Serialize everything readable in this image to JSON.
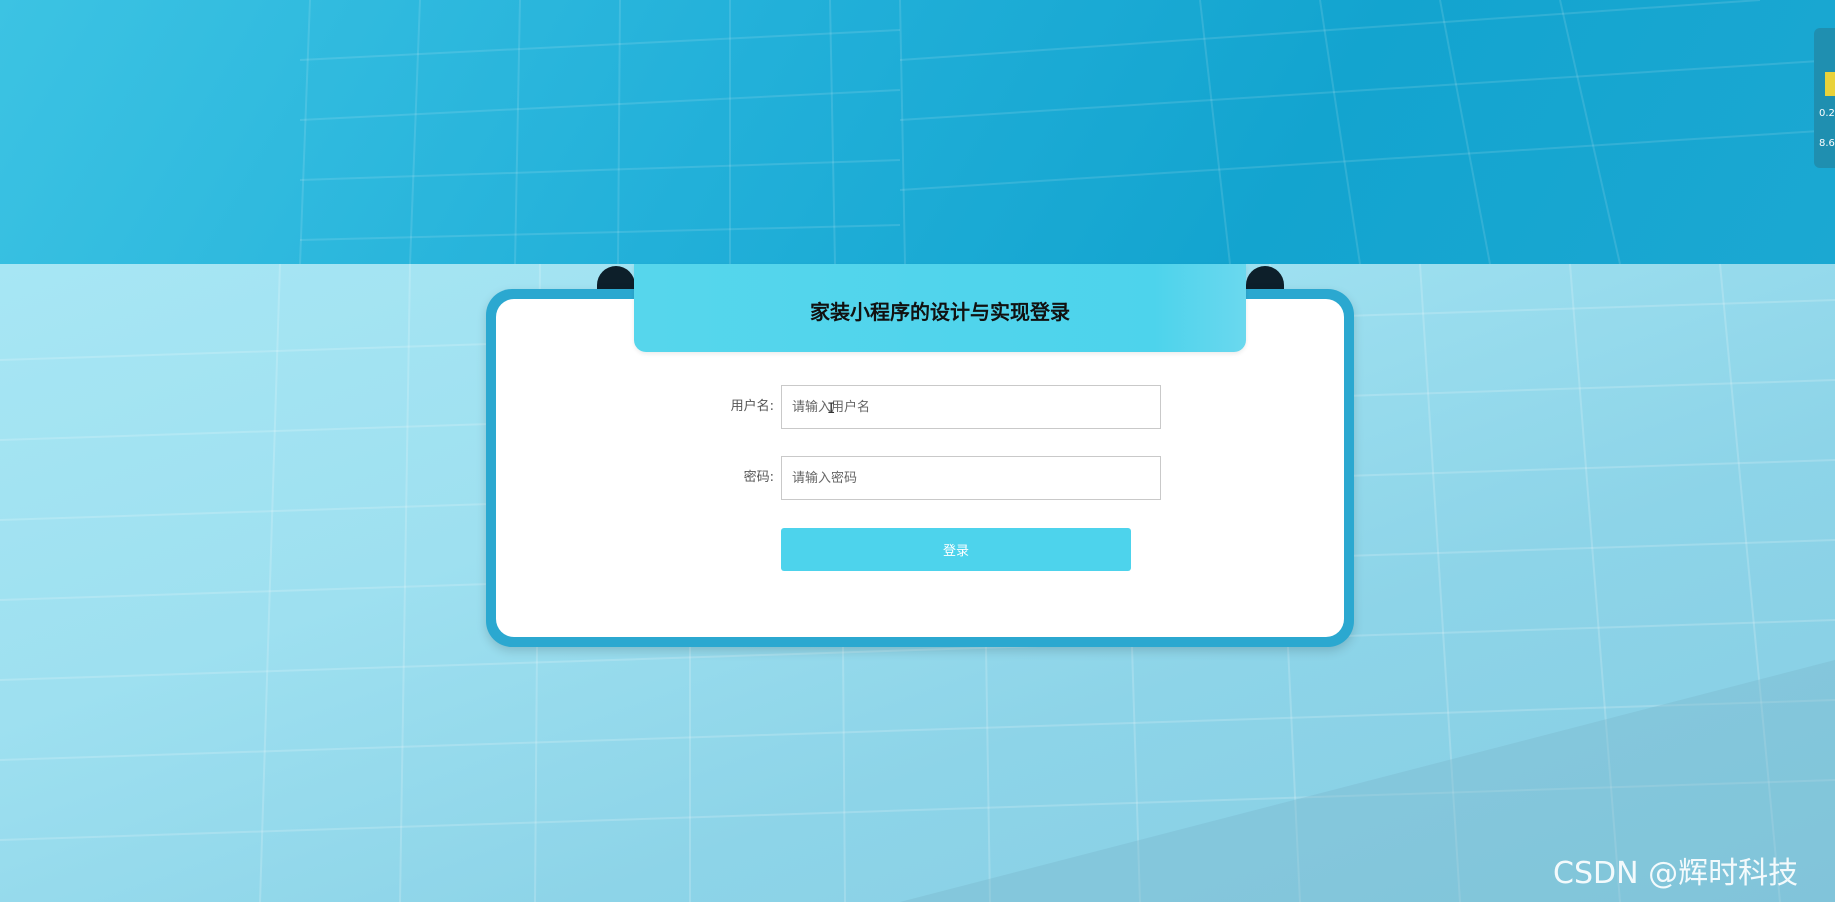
{
  "page": {
    "title": "家装小程序的设计与实现登录"
  },
  "form": {
    "username_label": "用户名:",
    "username_placeholder": "请输入用户名",
    "password_label": "密码:",
    "password_placeholder": "请输入密码",
    "login_label": "登录"
  },
  "side_widget": {
    "line1": "0.2",
    "line2": "8.6"
  },
  "watermark": "CSDN @辉时科技",
  "colors": {
    "accent": "#4dd3ec",
    "card_border": "#2ba8d0",
    "background_top": "#1aa9d3",
    "background_bottom": "#9fe2f0"
  }
}
